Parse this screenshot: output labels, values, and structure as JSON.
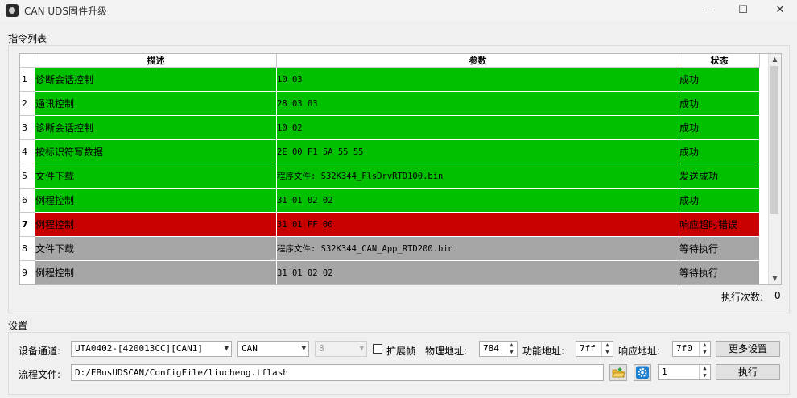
{
  "window": {
    "title": "CAN UDS固件升级",
    "minimize": "—",
    "maximize": "☐",
    "close": "✕"
  },
  "command_list": {
    "section_label": "指令列表",
    "columns": [
      "描述",
      "参数",
      "状态"
    ],
    "rows": [
      {
        "num": "1",
        "desc": "诊断会话控制",
        "param": "10 03",
        "status": "成功",
        "state": "green"
      },
      {
        "num": "2",
        "desc": "通讯控制",
        "param": "28 03 03",
        "status": "成功",
        "state": "green"
      },
      {
        "num": "3",
        "desc": "诊断会话控制",
        "param": "10 02",
        "status": "成功",
        "state": "green"
      },
      {
        "num": "4",
        "desc": "按标识符写数据",
        "param": "2E 00 F1 5A 55 55",
        "status": "成功",
        "state": "green"
      },
      {
        "num": "5",
        "desc": "文件下载",
        "param": "程序文件: S32K344_FlsDrvRTD100.bin",
        "status": "发送成功",
        "state": "green"
      },
      {
        "num": "6",
        "desc": "例程控制",
        "param": "31 01 02 02",
        "status": "成功",
        "state": "green"
      },
      {
        "num": "7",
        "desc": "例程控制",
        "param": "31 01 FF 00",
        "status": "响应超时错误",
        "state": "red"
      },
      {
        "num": "8",
        "desc": "文件下载",
        "param": "程序文件: S32K344_CAN_App_RTD200.bin",
        "status": "等待执行",
        "state": "gray"
      },
      {
        "num": "9",
        "desc": "例程控制",
        "param": "31 01 02 02",
        "status": "等待执行",
        "state": "gray"
      }
    ],
    "exec_count_label": "执行次数:",
    "exec_count_value": "0"
  },
  "settings": {
    "section_label": "设置",
    "device_channel_label": "设备通道:",
    "device_channel_value": "UTA0402-[420013CC][CAN1]",
    "bus_type_value": "CAN",
    "baud_value": "8",
    "extended_frame_label": "扩展帧",
    "physical_addr_label": "物理地址:",
    "physical_addr_value": "784",
    "functional_addr_label": "功能地址:",
    "functional_addr_value": "7ff",
    "response_addr_label": "响应地址:",
    "response_addr_value": "7f0",
    "more_settings_label": "更多设置",
    "flow_file_label": "流程文件:",
    "flow_file_value": "D:/EBusUDSCAN/ConfigFile/liucheng.tflash",
    "repeat_value": "1",
    "execute_label": "执行"
  }
}
